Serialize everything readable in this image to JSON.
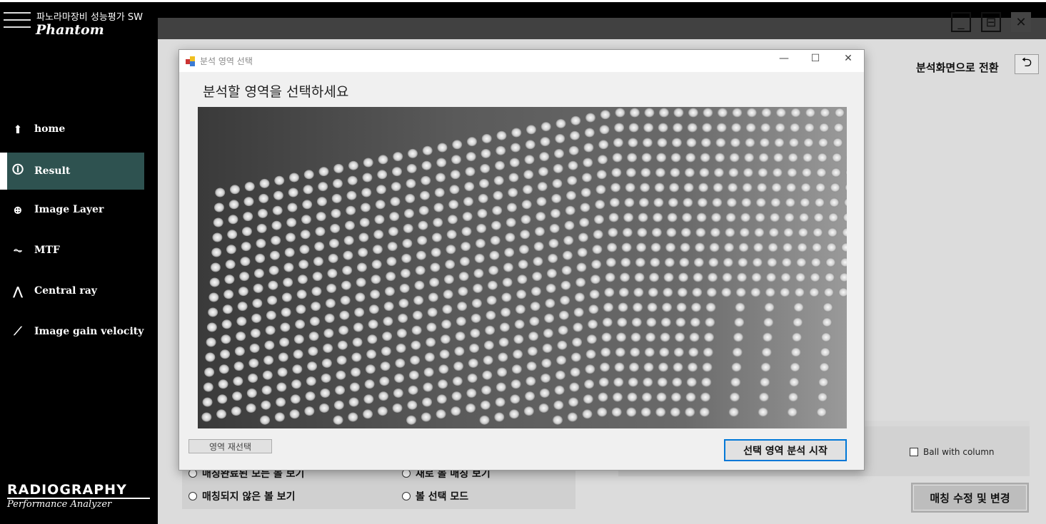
{
  "app": {
    "subtitle": "파노라마장비 성능평가 SW",
    "name": "Phantom"
  },
  "sidebar": {
    "items": [
      {
        "label": "home",
        "icon": "home-icon"
      },
      {
        "label": "Result",
        "icon": "info-icon",
        "active": true
      },
      {
        "label": "Image Layer",
        "icon": "crosshair-icon"
      },
      {
        "label": "MTF",
        "icon": "mtf-graph-icon"
      },
      {
        "label": "Central ray",
        "icon": "rays-icon"
      },
      {
        "label": "Image gain velocity",
        "icon": "pin-icon"
      }
    ]
  },
  "logo": {
    "line1": "RADIOGRAPHY",
    "line2": "Performance Analyzer"
  },
  "header": {
    "switch_label": "분석화면으로 전환"
  },
  "radios": [
    "매칭완료된 모든 볼 보기",
    "새로 볼 매칭 보기",
    "매칭되지 않은 볼 보기",
    "볼 선택 모드"
  ],
  "checkbox": {
    "label": "Ball  with  column",
    "checked": false
  },
  "match_button": "매칭 수정 및 변경",
  "dialog": {
    "title": "분석 영역 선택",
    "prompt": "분석할 영역을 선택하세요",
    "reselect": "영역 재선택",
    "start": "선택 영역 분석 시작"
  }
}
